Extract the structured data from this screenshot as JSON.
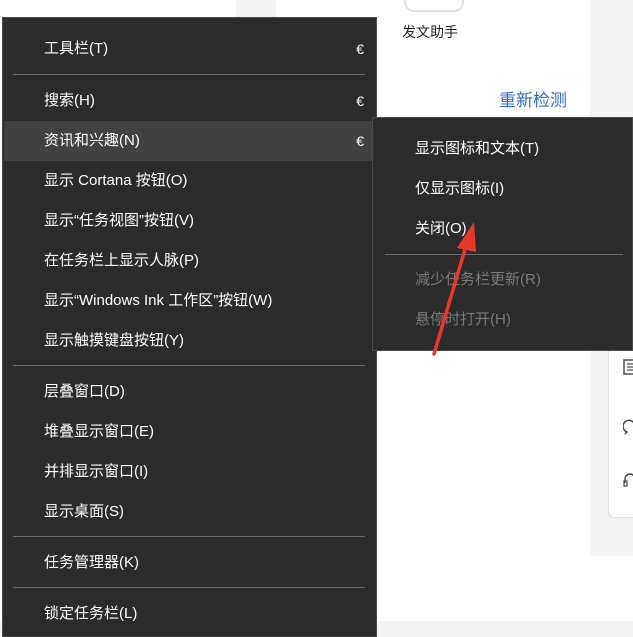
{
  "background": {
    "assistant_label": "发文助手",
    "recheck_link": "重新检测"
  },
  "menu": {
    "items": [
      {
        "label": "工具栏(T)",
        "arrow": "€"
      },
      {
        "label": "搜索(H)",
        "arrow": "€"
      },
      {
        "label": "资讯和兴趣(N)",
        "arrow": "€"
      },
      {
        "label": "显示 Cortana 按钮(O)"
      },
      {
        "label": "显示“任务视图”按钮(V)"
      },
      {
        "label": "在任务栏上显示人脉(P)"
      },
      {
        "label": "显示“Windows Ink 工作区”按钮(W)"
      },
      {
        "label": "显示触摸键盘按钮(Y)"
      },
      {
        "label": "层叠窗口(D)"
      },
      {
        "label": "堆叠显示窗口(E)"
      },
      {
        "label": "并排显示窗口(I)"
      },
      {
        "label": "显示桌面(S)"
      },
      {
        "label": "任务管理器(K)"
      },
      {
        "label": "锁定任务栏(L)"
      }
    ]
  },
  "submenu": {
    "items": [
      {
        "label": "显示图标和文本(T)",
        "enabled": true
      },
      {
        "label": "仅显示图标(I)",
        "enabled": true
      },
      {
        "label": "关闭(O)",
        "enabled": true
      },
      {
        "label": "减少任务栏更新(R)",
        "enabled": false
      },
      {
        "label": "悬停时打开(H)",
        "enabled": false
      }
    ]
  },
  "colors": {
    "menu_bg": "#2b2b2b",
    "hover_bg": "#414141",
    "link": "#2f6bd6",
    "annotation": "#e8372c"
  }
}
